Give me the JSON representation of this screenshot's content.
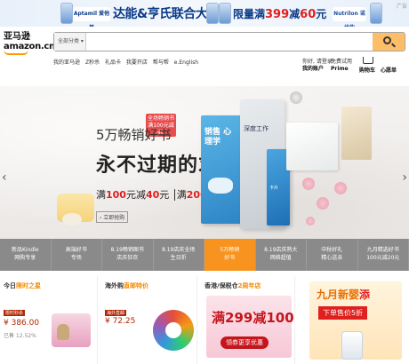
{
  "top_ad": {
    "brand_left": "Aptamil 爱他美",
    "headline": "达能&亨氏联合大牌日",
    "promo_prefix": "限量满",
    "promo_n1": "399",
    "promo_mid": "减",
    "promo_n2": "60",
    "promo_suffix": "元",
    "brand_right": "Nutrilon 诺优能",
    "ad_tag": "广告"
  },
  "logo": {
    "cn": "亚马逊",
    "en": "amazon.cn"
  },
  "search": {
    "scope": "全部分类 ▾",
    "placeholder": ""
  },
  "subnav": [
    "我的亚马逊",
    "Z秒杀",
    "礼品卡",
    "我要开店",
    "帮与帮",
    "e.English"
  ],
  "account": {
    "a_top": "你好, 请登录",
    "a_bottom": "我的账户",
    "prime_top": "免费试用",
    "prime_bottom": "Prime",
    "cart": "购物车",
    "wish": "心愿单"
  },
  "hero": {
    "tag": "全场畅销书 满100元减40",
    "title1": "5万畅销好书",
    "title2": "永不过期的求知欲",
    "deal_a1": "满",
    "deal_n1": "100",
    "deal_a2": "元减",
    "deal_n2": "40",
    "deal_a3": "元",
    "deal_a4": "满",
    "deal_n3": "200",
    "deal_a5": "元减",
    "deal_n4": "80",
    "deal_a6": "元",
    "more": "› 立即抢购",
    "book1": "销售 心理学",
    "book2": "深度工作",
    "book3": "卡片"
  },
  "tabs": [
    {
      "line1": "新品Kindle",
      "line2": "网购专享"
    },
    {
      "line1": "高端好书",
      "line2": "专场"
    },
    {
      "line1": "8.19畅销图书",
      "line2": "店庆狂欢"
    },
    {
      "line1": "8.19店庆全场",
      "line2": "生日折"
    },
    {
      "line1": "5万畅销",
      "line2": "好书"
    },
    {
      "line1": "8.19店庆熟大",
      "line2": "网络超值"
    },
    {
      "line1": "中秋好礼",
      "line2": "精心送亲"
    },
    {
      "line1": "九月精选好书",
      "line2": "100元减20元"
    }
  ],
  "blocks": {
    "b1_title": "今日",
    "b1_hl": "限时之星",
    "b1_chip": "限时秒杀",
    "b1_price": "¥ 386.00",
    "b1_sub": "已售 12.52%",
    "b2_title": "海外购",
    "b2_hl": "直邮",
    "b2_hl2": "特价",
    "b2_chip": "海外直邮",
    "b2_price": "¥ 72.25",
    "b3_title": "香港/",
    "b3_mid": "保税仓",
    "b3_hl": "2周年店",
    "b3_big1": "满",
    "b3_big_n1": "299",
    "b3_big2": "减",
    "b3_big_n2": "100",
    "b3_btn": "领券更享优惠",
    "b4_title": "九月新婴",
    "b4_hl": "添",
    "b4_sub": "下单售价5折"
  }
}
